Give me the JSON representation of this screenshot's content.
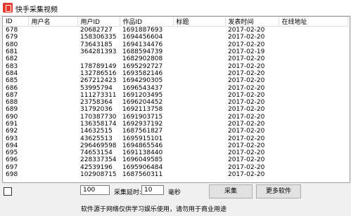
{
  "window": {
    "title": "快手采集视频"
  },
  "table": {
    "columns": [
      "ID",
      "用户名",
      "用户ID",
      "作品ID",
      "标题",
      "发表时间",
      "在线地址"
    ],
    "rows": [
      [
        "678",
        "",
        "20682727",
        "1691887693",
        "",
        "2017-02-20",
        ""
      ],
      [
        "679",
        "",
        "158306335",
        "1694456604",
        "",
        "2017-02-20",
        ""
      ],
      [
        "680",
        "",
        "73643185",
        "1694134476",
        "",
        "2017-02-20",
        ""
      ],
      [
        "681",
        "",
        "364281393",
        "1688594739",
        "",
        "2017-02-19",
        ""
      ],
      [
        "682",
        "",
        "",
        "1682902808",
        "",
        "2017-02-20",
        ""
      ],
      [
        "683",
        "",
        "178789149",
        "1695292727",
        "",
        "2017-02-20",
        ""
      ],
      [
        "684",
        "",
        "132786516",
        "1693582146",
        "",
        "2017-02-20",
        ""
      ],
      [
        "685",
        "",
        "267212423",
        "1694290305",
        "",
        "2017-02-20",
        ""
      ],
      [
        "686",
        "",
        "53995794",
        "1696543437",
        "",
        "2017-02-20",
        ""
      ],
      [
        "687",
        "",
        "111273311",
        "1691203495",
        "",
        "2017-02-20",
        ""
      ],
      [
        "688",
        "",
        "23758364",
        "1696204452",
        "",
        "2017-02-20",
        ""
      ],
      [
        "689",
        "",
        "31792036",
        "1692113758",
        "",
        "2017-02-20",
        ""
      ],
      [
        "690",
        "",
        "170387730",
        "1691903715",
        "",
        "2017-02-20",
        ""
      ],
      [
        "691",
        "",
        "136358174",
        "1692937192",
        "",
        "2017-02-20",
        ""
      ],
      [
        "692",
        "",
        "14632515",
        "1687561827",
        "",
        "2017-02-20",
        ""
      ],
      [
        "693",
        "",
        "43625513",
        "1695915101",
        "",
        "2017-02-20",
        ""
      ],
      [
        "694",
        "",
        "296469598",
        "1694865546",
        "",
        "2017-02-20",
        ""
      ],
      [
        "695",
        "",
        "74653154",
        "1691138440",
        "",
        "2017-02-20",
        ""
      ],
      [
        "696",
        "",
        "228337354",
        "1696049585",
        "",
        "2017-02-20",
        ""
      ],
      [
        "697",
        "",
        "42539196",
        "1695906484",
        "",
        "2017-02-20",
        ""
      ],
      [
        "698",
        "",
        "102908715",
        "1687560311",
        "",
        "2017-02-20",
        ""
      ]
    ]
  },
  "controls": {
    "checkbox_label": "",
    "count_value": "100",
    "interval_label": "采集延时:",
    "interval_value": "10",
    "interval_unit": "毫秒",
    "collect_button": "采集",
    "more_button": "更多软件",
    "notice": "软件源于网络仅供学习娱乐使用，请勿用于商业用途"
  },
  "colors": {
    "accent": "#e23b2e",
    "background": "#f0f0f0"
  }
}
